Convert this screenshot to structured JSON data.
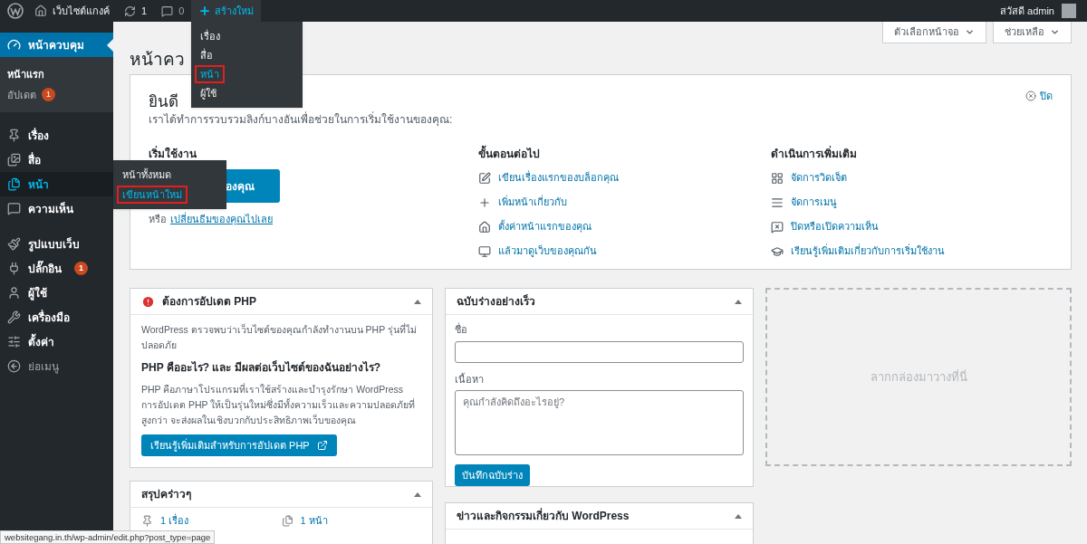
{
  "admin_bar": {
    "site_name": "เว็บไซต์แกงค์",
    "updates_count": "1",
    "comments_count": "0",
    "new_label": "สร้างใหม่",
    "greeting": "สวัสดี admin"
  },
  "new_menu": [
    {
      "label": "เรื่อง",
      "highlighted": false
    },
    {
      "label": "สื่อ",
      "highlighted": false
    },
    {
      "label": "หน้า",
      "highlighted": true
    },
    {
      "label": "ผู้ใช้",
      "highlighted": false
    }
  ],
  "sidebar": {
    "groups": [
      [
        {
          "kind": "menu",
          "label": "หน้าควบคุม",
          "current": true,
          "hovered": false,
          "children": [
            {
              "label": "หน้าแรก",
              "selected": true
            },
            {
              "label": "อัปเดต",
              "selected": false,
              "badge": "1"
            }
          ]
        }
      ],
      [
        {
          "kind": "menu",
          "label": "เรื่อง",
          "current": false,
          "hovered": false
        },
        {
          "kind": "menu",
          "label": "สื่อ",
          "current": false,
          "hovered": false
        },
        {
          "kind": "menu",
          "label": "หน้า",
          "current": false,
          "hovered": true,
          "flyout": [
            {
              "label": "หน้าทั้งหมด",
              "highlighted": false
            },
            {
              "label": "เขียนหน้าใหม่",
              "highlighted": true
            }
          ]
        },
        {
          "kind": "menu",
          "label": "ความเห็น",
          "current": false,
          "hovered": false
        }
      ],
      [
        {
          "kind": "menu",
          "label": "รูปแบบเว็บ",
          "current": false,
          "hovered": false
        },
        {
          "kind": "menu",
          "label": "ปลั๊กอิน",
          "current": false,
          "hovered": false,
          "badge": "1"
        },
        {
          "kind": "menu",
          "label": "ผู้ใช้",
          "current": false,
          "hovered": false
        },
        {
          "kind": "menu",
          "label": "เครื่องมือ",
          "current": false,
          "hovered": false
        },
        {
          "kind": "menu",
          "label": "ตั้งค่า",
          "current": false,
          "hovered": false
        },
        {
          "kind": "collapse",
          "label": "ย่อเมนู",
          "current": false,
          "hovered": false
        }
      ]
    ]
  },
  "top_buttons": [
    "ตัวเลือกหน้าจอ",
    "ช่วยเหลือ"
  ],
  "page_title": "หน้าคว",
  "welcome": {
    "heading": "ยินดี",
    "subtitle": "เราได้ทำการรวบรวมลิงก์บางอันเพื่อช่วยในการเริ่มใช้งานของคุณ:",
    "close": "ปิด",
    "start": {
      "heading": "เริ่มใช้งาน",
      "button": "องคุณ",
      "alt_prefix": "หรือ",
      "alt_link": "เปลี่ยนธีมของคุณไปเลย"
    },
    "next": {
      "heading": "ขั้นตอนต่อไป",
      "links": [
        "เขียนเรื่องแรกของบล็อกคุณ",
        "เพิ่มหน้าเกี่ยวกับ",
        "ตั้งค่าหน้าแรกของคุณ",
        "แล้วมาดูเว็บของคุณกัน"
      ]
    },
    "more": {
      "heading": "ดำเนินการเพิ่มเติม",
      "links": [
        "จัดการวิดเจ็ต",
        "จัดการเมนู",
        "ปิดหรือเปิดความเห็น",
        "เรียนรู้เพิ่มเติมเกี่ยวกับการเริ่มใช้งาน"
      ]
    }
  },
  "php_widget": {
    "title": "ต้องการอัปเดต PHP",
    "text": "WordPress ตรวจพบว่าเว็บไซต์ของคุณกำลังทำงานบน PHP รุ่นที่ไม่ปลอดภัย",
    "question": "PHP คืออะไร? และ มีผลต่อเว็บไซต์ของฉันอย่างไร?",
    "explanation": "PHP คือภาษาโปรแกรมที่เราใช้สร้างและบำรุงรักษา WordPress การอัปเดต PHP ให้เป็นรุ่นใหม่ซึ่งมีทั้งความเร็วและความปลอดภัยที่สูงกว่า จะส่งผลในเชิงบวกกับประสิทธิภาพเว็บของคุณ",
    "button": "เรียนรู้เพิ่มเติมสำหรับการอัปเดต PHP"
  },
  "summary_widget": {
    "title": "สรุปคร่าวๆ",
    "items": [
      "1 เรื่อง",
      "1 หน้า"
    ]
  },
  "draft_widget": {
    "title": "ฉบับร่างอย่างเร็ว",
    "title_label": "ชื่อ",
    "content_label": "เนื้อหา",
    "placeholder": "คุณกำลังคิดถึงอะไรอยู่?",
    "button": "บันทึกฉบับร่าง"
  },
  "news_widget": {
    "title": "ข่าวและกิจกรรมเกี่ยวกับ WordPress"
  },
  "drop_zone": "ลากกล่องมาวางที่นี่",
  "status_bar": "websitegang.in.th/wp-admin/edit.php?post_type=page"
}
